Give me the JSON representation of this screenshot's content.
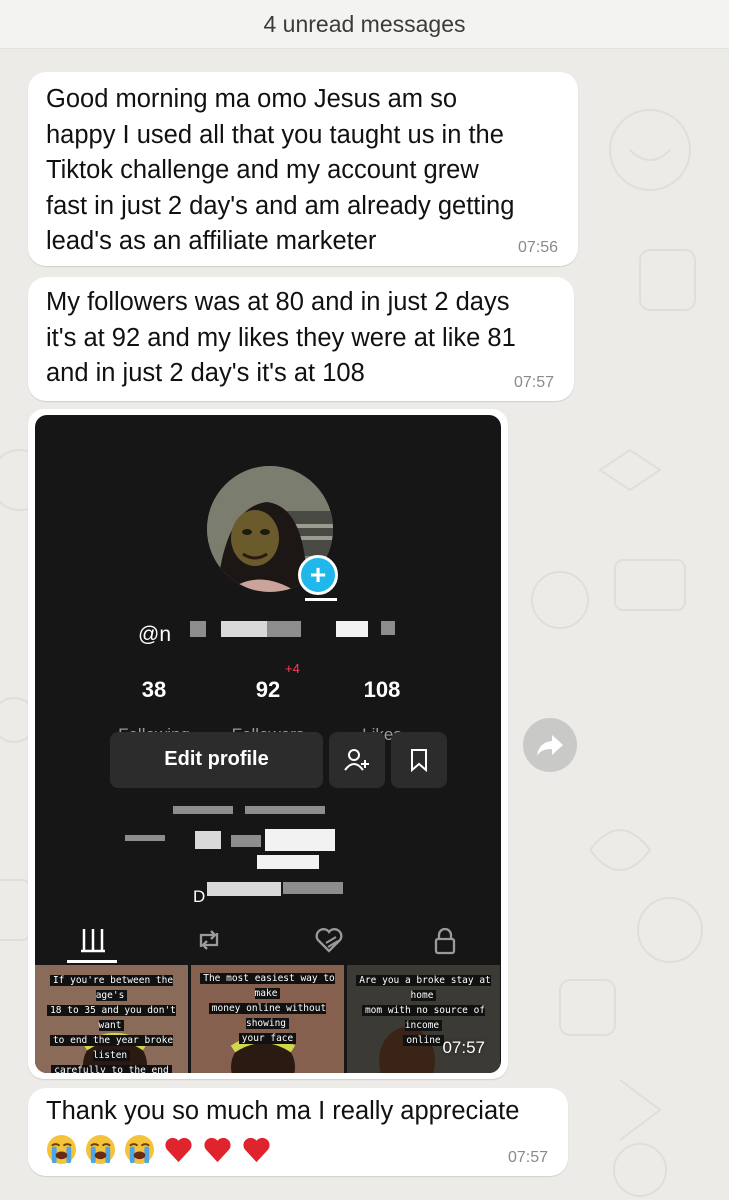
{
  "unread_banner": "4 unread messages",
  "messages": [
    {
      "text": "Good morning ma omo Jesus am so\nhappy I used all that you taught us in the\nTiktok challenge and my account grew\nfast in just 2 day's and am already getting\nlead's as an affiliate marketer",
      "time": "07:56"
    },
    {
      "text": "My followers was at 80 and in just 2 days\nit's at 92 and my likes they were at like 81\nand in just 2 day's it's at 108",
      "time": "07:57"
    },
    {
      "text": "Thank you so much ma I really appreciate",
      "emojis": [
        "loudly-crying-face",
        "loudly-crying-face",
        "loudly-crying-face",
        "red-heart",
        "red-heart",
        "red-heart"
      ],
      "time": "07:57"
    }
  ],
  "image_message": {
    "time": "07:57",
    "profile": {
      "username_prefix": "@n",
      "stats": [
        {
          "value": "38",
          "label": "Following"
        },
        {
          "value": "92",
          "label": "Followers",
          "delta": "+4"
        },
        {
          "value": "108",
          "label": "Likes"
        }
      ],
      "edit_button": "Edit profile",
      "bio_line_visible": "D",
      "tabs": [
        "grid-icon",
        "repost-icon",
        "liked-icon",
        "lock-icon"
      ],
      "videos": [
        {
          "caption": [
            "If you're between the age's",
            "18 to 35 and you don't want",
            "to end the year broke listen",
            "carefully to the end"
          ]
        },
        {
          "caption": [
            "The most easiest way to make",
            "money online without showing",
            "your face"
          ]
        },
        {
          "caption": [
            "Are you a broke stay at home",
            "mom with no source of income",
            "online"
          ]
        }
      ]
    }
  },
  "colors": {
    "chat_background": "#ecebe8",
    "bubble": "#ffffff",
    "tiktok_background": "#161616",
    "accent_plus": "#20b7ea",
    "delta_red": "#ff3b5c"
  }
}
